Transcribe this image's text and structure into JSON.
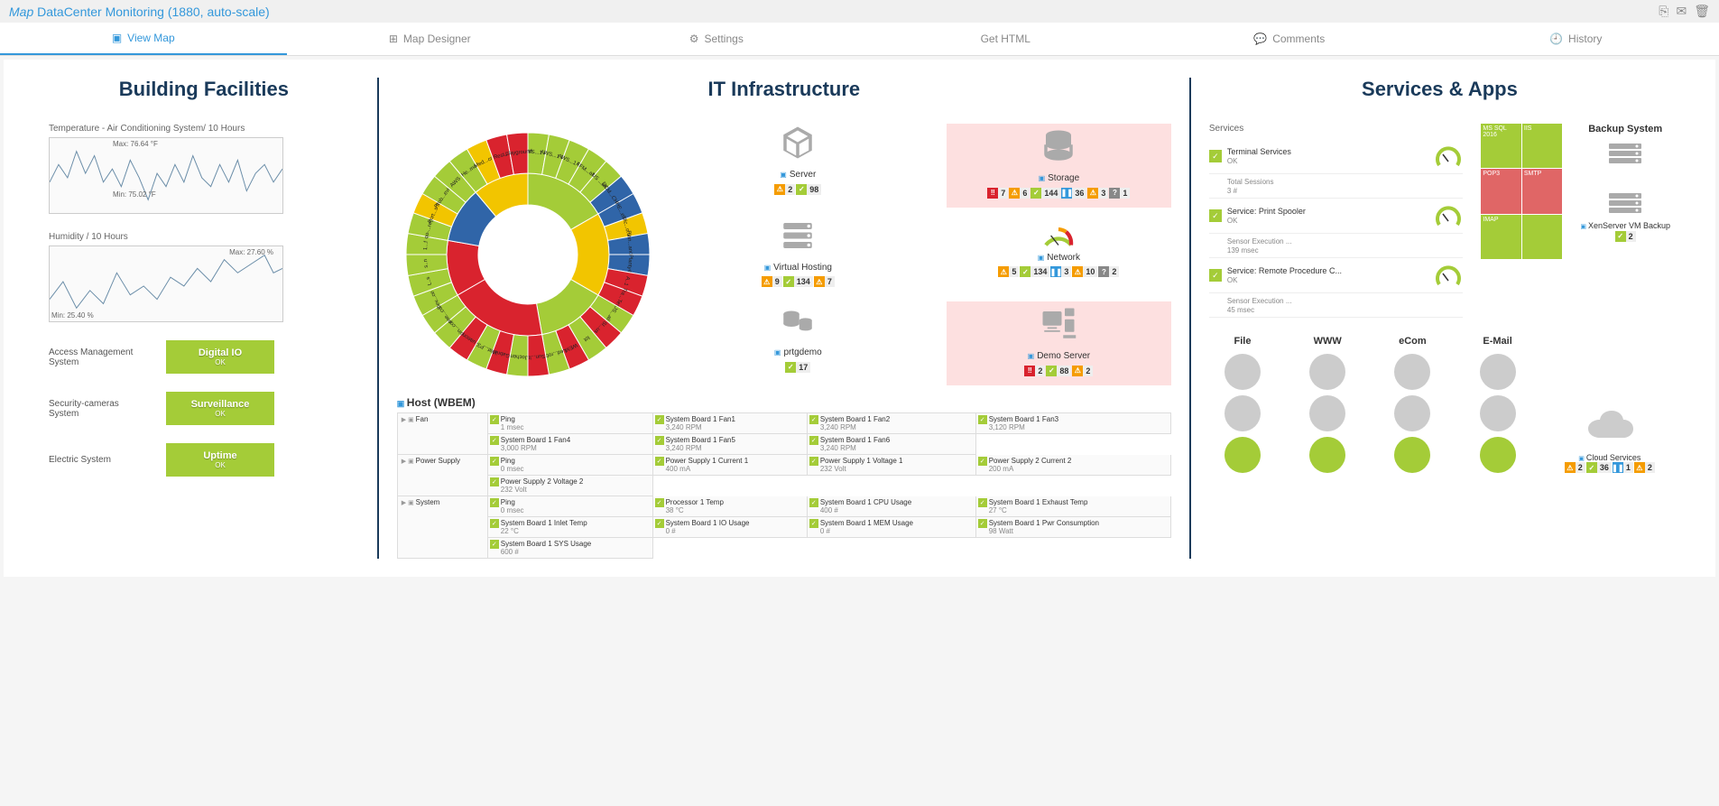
{
  "header": {
    "map_label": "Map",
    "title": "DataCenter Monitoring (1880, auto-scale)"
  },
  "tabs": [
    {
      "icon": "▣",
      "label": "View Map",
      "active": true
    },
    {
      "icon": "⊞",
      "label": "Map Designer"
    },
    {
      "icon": "⚙",
      "label": "Settings"
    },
    {
      "icon": "</>",
      "label": "Get HTML"
    },
    {
      "icon": "💬",
      "label": "Comments"
    },
    {
      "icon": "🕘",
      "label": "History"
    }
  ],
  "facilities": {
    "title": "Building Facilities",
    "temp": {
      "label": "Temperature - Air Conditioning System/ 10 Hours",
      "max": "Max: 76.64 °F",
      "min": "Min: 75.02 °F"
    },
    "humidity": {
      "label": "Humidity / 10 Hours",
      "max": "Max: 27.60 %",
      "min": "Min: 25.40 %"
    },
    "rows": [
      {
        "label": "Access Management System",
        "status": "Digital IO",
        "sub": "OK"
      },
      {
        "label": "Security-cameras System",
        "status": "Surveillance",
        "sub": "OK"
      },
      {
        "label": "Electric System",
        "status": "Uptime",
        "sub": "OK"
      }
    ]
  },
  "it": {
    "title": "IT Infrastructure",
    "sunburst_labels": [
      "AWS...1 AU",
      "AWS...1 DE",
      "AWS...1 US",
      "FFM...alth",
      "US ...alth",
      "DCM...CHEE",
      "IHE...elle",
      "dic...o.uk",
      "Plan...anced",
      "Planty4",
      "A..1",
      "Tra...Test",
      "JS...all",
      "SI...us",
      "lot",
      "WEM",
      "Led...robe",
      "Sun...lt",
      "Jochen",
      "Gabriel",
      "Wat...P320",
      "uaeon",
      "pin...com",
      "pae...com",
      "Dev...ce 1 ",
      "L..s",
      "s..n",
      "1...f",
      "qo-...reg)",
      "Port...s tbd",
      "Prob...evice",
      "AWS",
      "He..mo",
      "Med...crit",
      "Rest...",
      "playground"
    ],
    "items": [
      {
        "name": "Server",
        "icon": "cube",
        "badges": [
          {
            "t": "orange",
            "v": "2"
          },
          {
            "t": "green",
            "v": "98"
          }
        ]
      },
      {
        "name": "Storage",
        "icon": "db",
        "pink": true,
        "badges": [
          {
            "t": "red",
            "v": "7"
          },
          {
            "t": "orange",
            "v": "6"
          },
          {
            "t": "green",
            "v": "144"
          },
          {
            "t": "blue",
            "v": "36"
          },
          {
            "t": "orange",
            "v": "3"
          },
          {
            "t": "grey",
            "v": "1"
          }
        ]
      },
      {
        "name": "Virtual Hosting",
        "icon": "server",
        "badges": [
          {
            "t": "orange",
            "v": "9"
          },
          {
            "t": "green",
            "v": "134"
          },
          {
            "t": "orange",
            "v": "7"
          }
        ]
      },
      {
        "name": "Network",
        "icon": "gauge",
        "badges": [
          {
            "t": "orange",
            "v": "5"
          },
          {
            "t": "green",
            "v": "134"
          },
          {
            "t": "blue",
            "v": "3"
          },
          {
            "t": "orange",
            "v": "10"
          },
          {
            "t": "grey",
            "v": "2"
          }
        ]
      },
      {
        "name": "prtgdemo",
        "icon": "dbcluster",
        "badges": [
          {
            "t": "green",
            "v": "17"
          }
        ]
      },
      {
        "name": "Demo Server",
        "icon": "pc",
        "pink": true,
        "badges": [
          {
            "t": "red",
            "v": "2"
          },
          {
            "t": "green",
            "v": "88"
          },
          {
            "t": "orange",
            "v": "2"
          }
        ]
      }
    ],
    "host": {
      "title": "Host (WBEM)",
      "groups": [
        {
          "cat": "Fan",
          "sensors": [
            {
              "n": "Ping",
              "v": "1 msec"
            },
            {
              "n": "System Board 1 Fan1",
              "v": "3,240 RPM"
            },
            {
              "n": "System Board 1 Fan2",
              "v": "3,240 RPM"
            },
            {
              "n": "System Board 1 Fan3",
              "v": "3,120 RPM"
            },
            {
              "n": "System Board 1 Fan4",
              "v": "3,000 RPM"
            },
            {
              "n": "System Board 1 Fan5",
              "v": "3,240 RPM"
            },
            {
              "n": "System Board 1 Fan6",
              "v": "3,240 RPM"
            },
            {
              "n": "",
              "v": ""
            }
          ]
        },
        {
          "cat": "Power Supply",
          "sensors": [
            {
              "n": "Ping",
              "v": "0 msec"
            },
            {
              "n": "Power Supply 1 Current 1",
              "v": "400 mA"
            },
            {
              "n": "Power Supply 1 Voltage 1",
              "v": "232 Volt"
            },
            {
              "n": "Power Supply 2 Current 2",
              "v": "200 mA"
            },
            {
              "n": "Power Supply 2 Voltage 2",
              "v": "232 Volt"
            },
            {
              "n": "",
              "v": ""
            },
            {
              "n": "",
              "v": ""
            },
            {
              "n": "",
              "v": ""
            }
          ]
        },
        {
          "cat": "System",
          "sensors": [
            {
              "n": "Ping",
              "v": "0 msec"
            },
            {
              "n": "Processor 1 Temp",
              "v": "38 °C"
            },
            {
              "n": "System Board 1 CPU Usage",
              "v": "400 #"
            },
            {
              "n": "System Board 1 Exhaust Temp",
              "v": "27 °C"
            },
            {
              "n": "System Board 1 Inlet Temp",
              "v": "22 °C"
            },
            {
              "n": "System Board 1 IO Usage",
              "v": "0 #"
            },
            {
              "n": "System Board 1 MEM Usage",
              "v": "0 #"
            },
            {
              "n": "System Board 1 Pwr Consumption",
              "v": "98 Watt"
            },
            {
              "n": "System Board 1 SYS Usage",
              "v": "600 #"
            },
            {
              "n": "",
              "v": ""
            },
            {
              "n": "",
              "v": ""
            },
            {
              "n": "",
              "v": ""
            }
          ]
        }
      ]
    }
  },
  "services": {
    "title": "Services & Apps",
    "list_label": "Services",
    "list": [
      {
        "title": "Terminal Services",
        "status": "OK",
        "sub_label": "Total Sessions",
        "sub_val": "3 #"
      },
      {
        "title": "Service: Print Spooler",
        "status": "OK",
        "sub_label": "Sensor Execution ...",
        "sub_val": "139 msec"
      },
      {
        "title": "Service: Remote Procedure C...",
        "status": "OK",
        "sub_label": "Sensor Execution ...",
        "sub_val": "45 msec"
      }
    ],
    "treemap": [
      "MS SQL 2016",
      "IIS",
      "POP3",
      "SMTP",
      "IMAP",
      ""
    ],
    "backup": {
      "title": "Backup System",
      "label": "XenServer VM Backup",
      "badges": [
        {
          "t": "green",
          "v": "2"
        }
      ]
    },
    "traffic": [
      {
        "label": "File"
      },
      {
        "label": "WWW"
      },
      {
        "label": "eCom"
      },
      {
        "label": "E-Mail"
      }
    ],
    "cloud": {
      "label": "Cloud Services",
      "badges": [
        {
          "t": "orange",
          "v": "2"
        },
        {
          "t": "green",
          "v": "36"
        },
        {
          "t": "blue",
          "v": "1"
        },
        {
          "t": "orange",
          "v": "2"
        }
      ]
    }
  }
}
